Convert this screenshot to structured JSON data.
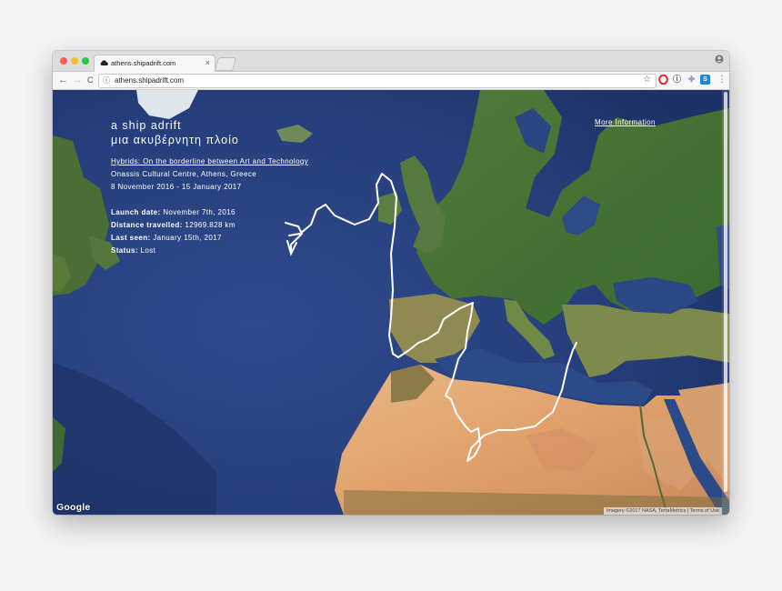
{
  "browser": {
    "tab_title": "athens.shipadrift.com",
    "tab_close_glyph": "×",
    "url": "athens.shipadrift.com",
    "nav": {
      "back_glyph": "←",
      "forward_glyph": "→",
      "reload_glyph": "C"
    },
    "extensions": [
      {
        "name": "opera-icon",
        "glyph": "O",
        "color": "#e0262d"
      },
      {
        "name": "info-extension-icon",
        "glyph": "ⓘ",
        "color": "#666666"
      },
      {
        "name": "puzzle-extension-icon",
        "glyph": "✚",
        "color": "#8aa0c8"
      },
      {
        "name": "s-extension-icon",
        "glyph": "S",
        "color": "#1f86d6"
      }
    ],
    "menu_glyph": "⋮"
  },
  "page": {
    "title_en": "a ship adrift",
    "title_gr": "μια ακυβέρνητη πλοίο",
    "exhibition_link": "Hybrids: On the borderline between Art and Technology",
    "venue": "Onassis Cultural Centre, Athens, Greece",
    "dates": "8 November 2016 - 15 January 2017",
    "stats": [
      {
        "label": "Launch date:",
        "value": "November 7th, 2016"
      },
      {
        "label": "Distance travelled:",
        "value": "12969.828 km"
      },
      {
        "label": "Last seen:",
        "value": "January 15th, 2017"
      },
      {
        "label": "Status:",
        "value": "Lost"
      }
    ],
    "more_info": "More Information"
  },
  "map": {
    "google_logo": "Google",
    "attribution": "Imagery ©2017 NASA, TerraMetrics | Terms of Use",
    "track_color": "#ffffff"
  }
}
